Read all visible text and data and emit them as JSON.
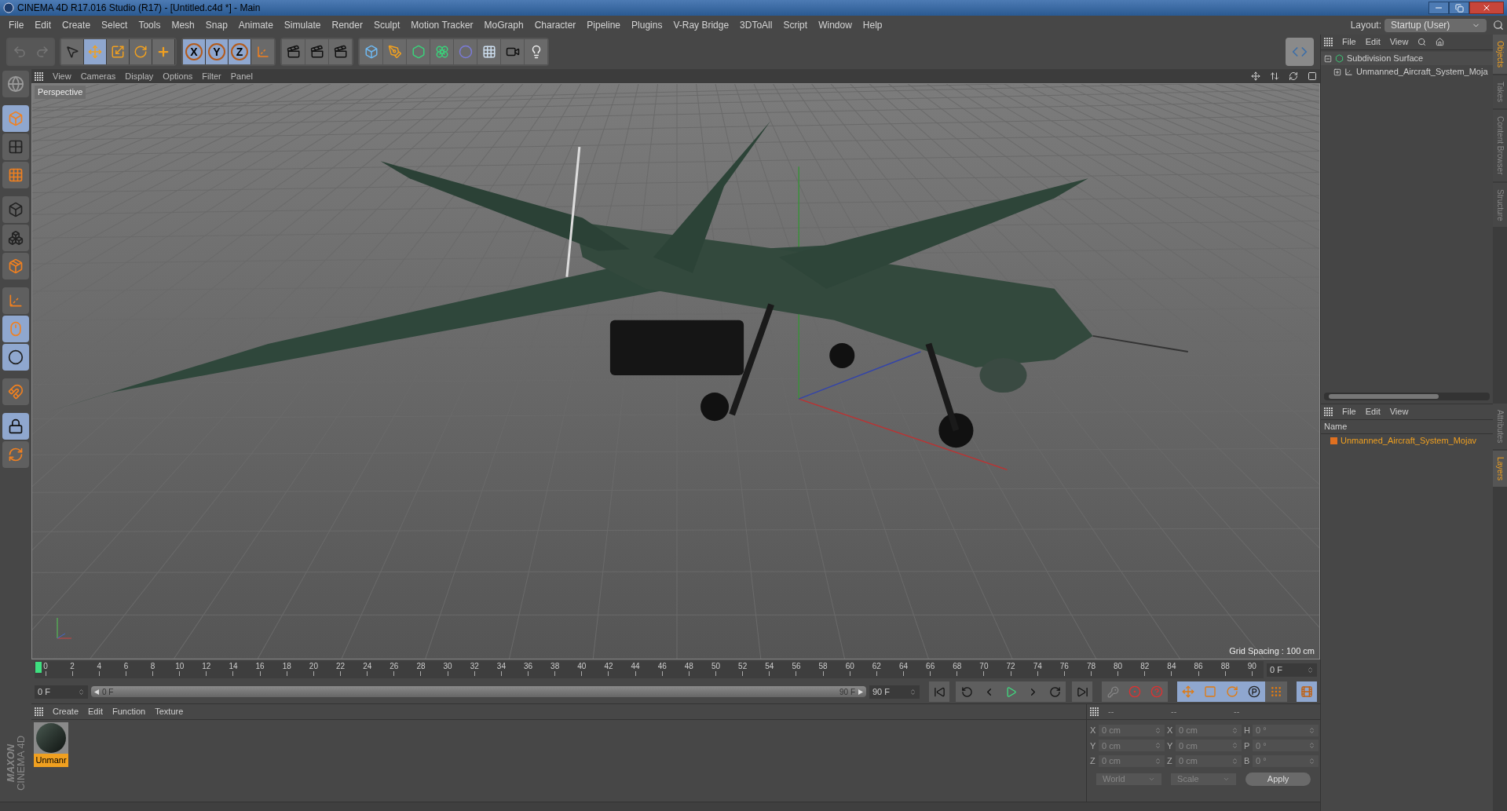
{
  "window": {
    "title": "CINEMA 4D R17.016 Studio (R17) - [Untitled.c4d *] - Main"
  },
  "menu": [
    "File",
    "Edit",
    "Create",
    "Select",
    "Tools",
    "Mesh",
    "Snap",
    "Animate",
    "Simulate",
    "Render",
    "Sculpt",
    "Motion Tracker",
    "MoGraph",
    "Character",
    "Pipeline",
    "Plugins",
    "V-Ray Bridge",
    "3DToAll",
    "Script",
    "Window",
    "Help"
  ],
  "layout": {
    "label": "Layout:",
    "value": "Startup (User)"
  },
  "tools": [
    {
      "selected": false
    },
    {
      "selected": true
    },
    {
      "selected": false
    },
    {
      "selected": false
    },
    {
      "selected": false
    }
  ],
  "axes": [
    {
      "label": "X",
      "selected": true
    },
    {
      "label": "Y",
      "selected": true
    },
    {
      "label": "Z",
      "selected": true
    }
  ],
  "left_tools": [
    {
      "selected": true
    },
    {
      "selected": false
    },
    {
      "selected": false
    },
    {
      "selected": false
    },
    {
      "selected": false
    },
    {
      "selected": false
    },
    {
      "selected": false
    },
    {
      "selected": true
    },
    {
      "selected": true
    },
    {
      "selected": false
    },
    {
      "selected": true
    },
    {
      "selected": false
    }
  ],
  "viewport": {
    "menu": [
      "View",
      "Cameras",
      "Display",
      "Options",
      "Filter",
      "Panel"
    ],
    "camera": "Perspective",
    "grid_spacing": "Grid Spacing : 100 cm"
  },
  "timeline": {
    "ticks": [
      "0",
      "2",
      "4",
      "6",
      "8",
      "10",
      "12",
      "14",
      "16",
      "18",
      "20",
      "22",
      "24",
      "26",
      "28",
      "30",
      "32",
      "34",
      "36",
      "38",
      "40",
      "42",
      "44",
      "46",
      "48",
      "50",
      "52",
      "54",
      "56",
      "58",
      "60",
      "62",
      "64",
      "66",
      "68",
      "70",
      "72",
      "74",
      "76",
      "78",
      "80",
      "82",
      "84",
      "86",
      "88",
      "90"
    ],
    "current_frame": "0 F",
    "start_field": "0 F",
    "range": {
      "start": "0 F",
      "end": "90 F",
      "level": 1
    },
    "end_field": "90 F"
  },
  "key_modes": [
    {
      "selected": true
    },
    {
      "selected": true
    },
    {
      "selected": true
    },
    {
      "selected": true
    },
    {
      "selected": false
    }
  ],
  "materials": {
    "menu": [
      "Create",
      "Edit",
      "Function",
      "Texture"
    ],
    "items": [
      {
        "name": "Unmanr",
        "selected": true
      }
    ]
  },
  "coordinates": {
    "headers": [
      "--",
      "--",
      "--"
    ],
    "rows": [
      [
        {
          "axis": "X",
          "value": "0 cm"
        },
        {
          "axis": "X",
          "value": "0 cm"
        },
        {
          "axis": "H",
          "value": "0 °"
        }
      ],
      [
        {
          "axis": "Y",
          "value": "0 cm"
        },
        {
          "axis": "Y",
          "value": "0 cm"
        },
        {
          "axis": "P",
          "value": "0 °"
        }
      ],
      [
        {
          "axis": "Z",
          "value": "0 cm"
        },
        {
          "axis": "Z",
          "value": "0 cm"
        },
        {
          "axis": "B",
          "value": "0 °"
        }
      ]
    ],
    "mode": "World",
    "size_mode": "Scale",
    "apply": "Apply"
  },
  "objects": {
    "menu": [
      "File",
      "Edit",
      "View"
    ],
    "tree": [
      {
        "name": "Subdivision Surface",
        "expanded": true,
        "children": [
          {
            "name": "Unmanned_Aircraft_System_Moja",
            "expanded": false
          }
        ]
      }
    ]
  },
  "side_tabs_top": [
    {
      "label": "Objects",
      "selected": true
    },
    {
      "label": "Takes",
      "selected": false
    },
    {
      "label": "Content Browser",
      "selected": false
    },
    {
      "label": "Structure",
      "selected": false
    }
  ],
  "layers": {
    "menu": [
      "File",
      "Edit",
      "View"
    ],
    "column": "Name",
    "rows": [
      {
        "name": "Unmanned_Aircraft_System_Mojav",
        "color": "#e07020"
      }
    ]
  },
  "side_tabs_bottom": [
    {
      "label": "Attributes",
      "selected": false
    },
    {
      "label": "Layers",
      "selected": true
    }
  ],
  "brand": {
    "maker": "MAXON",
    "product": "CINEMA 4D"
  }
}
